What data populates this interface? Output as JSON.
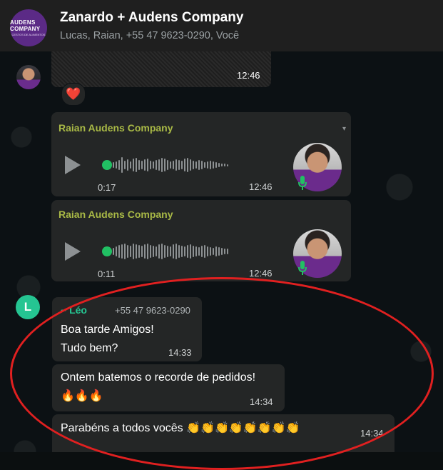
{
  "header": {
    "title": "Zanardo + Audens Company",
    "members": "Lucas, Raian, +55 47 9623-0290, Você",
    "logo_text": "AUDENS COMPANY",
    "logo_sub": "CESTOS DE ALIMENTOS"
  },
  "messages": {
    "image_time": "12:46",
    "reaction": "❤️",
    "voice1": {
      "sender": "Raian Audens Company",
      "duration": "0:17",
      "time": "12:46",
      "progress": 0
    },
    "voice2": {
      "sender": "Raian Audens Company",
      "duration": "0:11",
      "time": "12:46",
      "progress": 0
    },
    "leo": {
      "avatar_letter": "L",
      "name": "~ Léo",
      "phone": "+55 47 9623-0290",
      "msg1_line1": "Boa tarde Amigos!",
      "msg1_line2": "Tudo bem?",
      "msg1_time": "14:33",
      "msg2_line1": "Ontem batemos o recorde de pedidos!",
      "msg2_line2": "🔥🔥🔥",
      "msg2_time": "14:34",
      "msg3": "Parabéns a todos vocês 👏👏👏👏👏👏👏👏",
      "msg3_time": "14:34"
    }
  },
  "colors": {
    "sender_raian": "#a9b946",
    "sender_leo": "#25c592",
    "annotation": "#e02020"
  }
}
